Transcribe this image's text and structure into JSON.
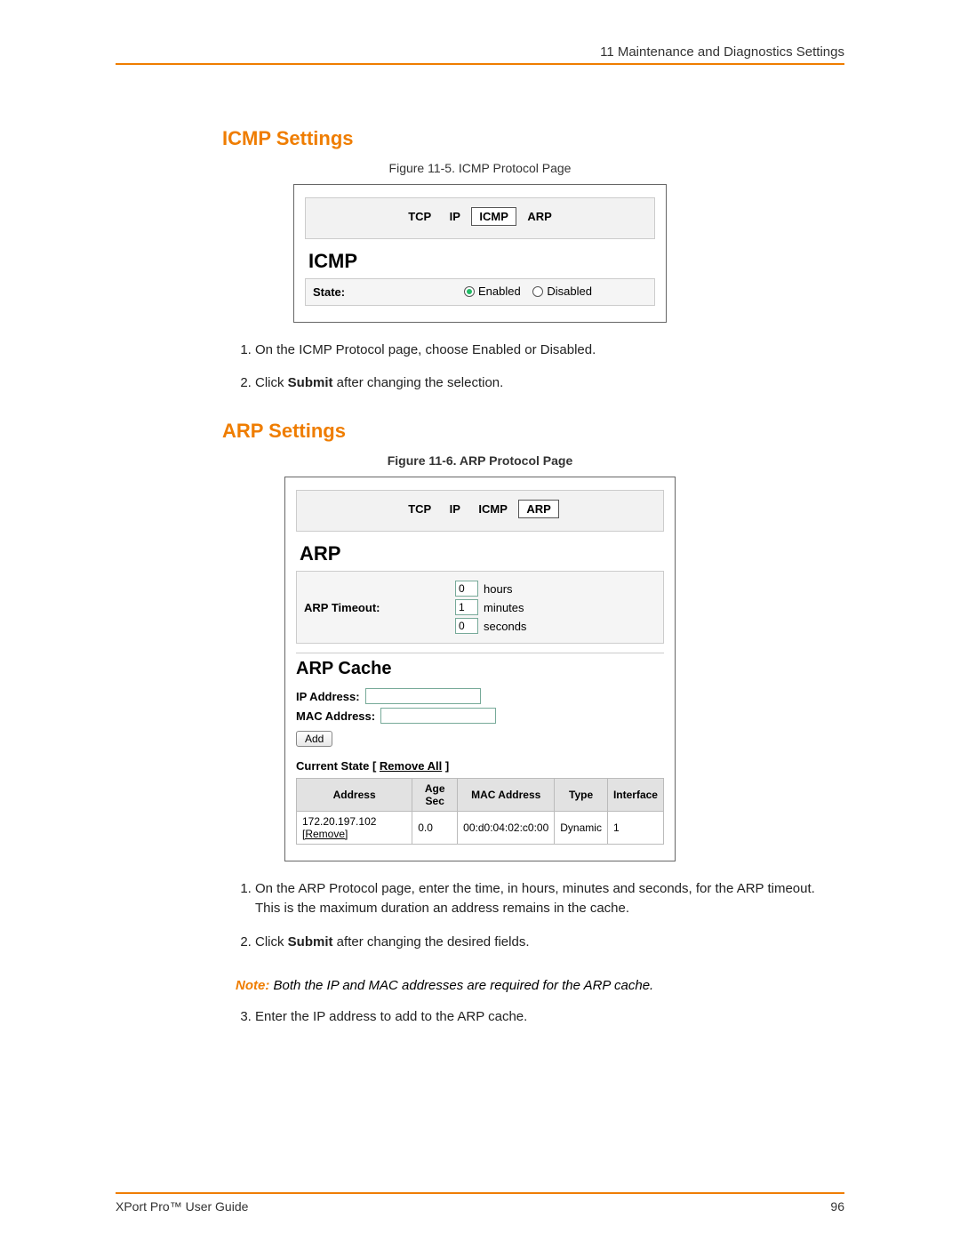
{
  "header": {
    "chapter": "11  Maintenance and Diagnostics Settings"
  },
  "sections": {
    "icmp": {
      "title": "ICMP Settings",
      "caption": "Figure 11-5. ICMP Protocol Page",
      "panel": {
        "tabs": [
          "TCP",
          "IP",
          "ICMP",
          "ARP"
        ],
        "active_tab": "ICMP",
        "heading": "ICMP",
        "state_label": "State:",
        "options": {
          "enabled": "Enabled",
          "disabled": "Disabled"
        },
        "selected": "Enabled"
      },
      "steps": [
        {
          "text": "On the ICMP Protocol page, choose Enabled or Disabled."
        },
        {
          "prefix": "Click ",
          "bold": "Submit",
          "suffix": " after changing the selection."
        }
      ]
    },
    "arp": {
      "title": "ARP Settings",
      "caption": "Figure 11-6. ARP Protocol Page",
      "panel": {
        "tabs": [
          "TCP",
          "IP",
          "ICMP",
          "ARP"
        ],
        "active_tab": "ARP",
        "heading": "ARP",
        "timeout_label": "ARP Timeout:",
        "timeout": {
          "hours": "0",
          "minutes": "1",
          "seconds": "0",
          "hours_label": "hours",
          "minutes_label": "minutes",
          "seconds_label": "seconds"
        },
        "cache_heading": "ARP Cache",
        "ip_label": "IP Address:",
        "mac_label": "MAC Address:",
        "add_button": "Add",
        "current_state_prefix": "Current State [ ",
        "remove_all": "Remove All",
        "current_state_suffix": " ]",
        "table": {
          "headers": [
            "Address",
            "Age Sec",
            "MAC Address",
            "Type",
            "Interface"
          ],
          "row": {
            "address": "172.20.197.102",
            "remove": "[Remove]",
            "age": "0.0",
            "mac": "00:d0:04:02:c0:00",
            "type": "Dynamic",
            "iface": "1"
          }
        }
      },
      "steps": [
        {
          "text": "On the ARP Protocol page, enter the time, in hours, minutes and seconds, for the ARP timeout. This is the maximum duration an address remains in the cache."
        },
        {
          "prefix": "Click ",
          "bold": "Submit",
          "suffix": " after changing the desired fields."
        }
      ],
      "note": {
        "label": "Note:",
        "text": " Both the IP and MAC addresses are required for the ARP cache."
      },
      "steps2": [
        {
          "text": "Enter the IP address to add to the ARP cache."
        }
      ]
    }
  },
  "footer": {
    "left": "XPort Pro™ User Guide",
    "page": "96"
  }
}
